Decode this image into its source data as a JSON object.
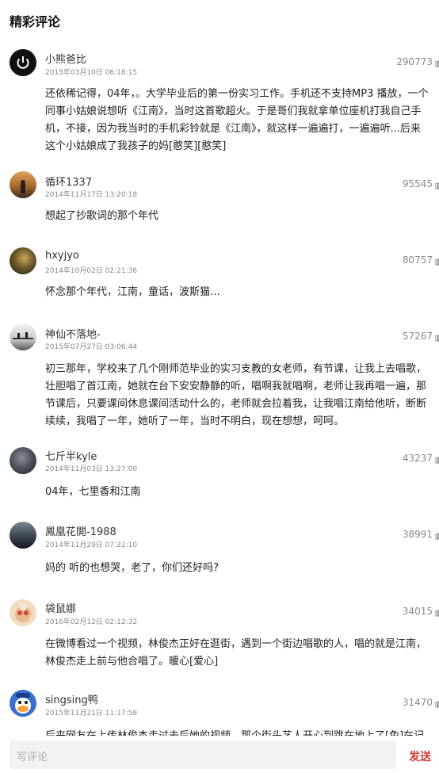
{
  "header": {
    "title": "精彩评论"
  },
  "comments": [
    {
      "user": "小熊爸比",
      "date": "2015年03月10日 06:18:15",
      "likes": "290773",
      "text": "还依稀记得，04年，。大学毕业后的第一份实习工作。手机还不支持MP3 播放，一个同事小姑娘说想听《江南》，当时这首歌超火。于是哥们我就拿单位座机打我自己手机，不接，因为我当时的手机彩铃就是《江南》，就这样一遍遍打，一遍遍听...后来这个小姑娘成了我孩子的妈[憨笑][憨笑]"
    },
    {
      "user": "循环1337",
      "date": "2014年11月17日 13:20:18",
      "likes": "95545",
      "text": "想起了抄歌词的那个年代"
    },
    {
      "user": "hxyjyo",
      "date": "2014年10月02日 02:21:36",
      "likes": "80757",
      "text": "怀念那个年代，江南，童话，波斯猫…"
    },
    {
      "user": "神仙不落地-",
      "date": "2015年07月27日 03:06:44",
      "likes": "57267",
      "text": "初三那年，学校来了几个刚师范毕业的实习支教的女老师，有节课，让我上去唱歌，壮胆唱了首江南，她就在台下安安静静的听，唱啊我就唱啊，老师让我再唱一遍，那节课后，只要课间休息课间活动什么的，老师就会拉着我，让我唱江南给他听，断断续续，我唱了一年，她听了一年，当时不明白，现在想想，呵呵。"
    },
    {
      "user": "七斤半kyle",
      "date": "2014年11月03日 13:27:00",
      "likes": "43237",
      "text": "04年，七里香和江南"
    },
    {
      "user": "鳳凰花開-1988",
      "date": "2014年11月29日 07:22:10",
      "likes": "38991",
      "text": "妈的 听的也想哭，老了，你们还好吗?"
    },
    {
      "user": "袋鼠娜",
      "date": "2016年02月12日 02:12:32",
      "likes": "34015",
      "text": "在微博看过一个视频，林俊杰正好在逛街，遇到一个街边唱歌的人，唱的就是江南，林俊杰走上前与他合唱了。暖心[爱心]"
    },
    {
      "user": "singsing鸭",
      "date": "2015年11月21日 11:17:58",
      "likes": "31470",
      "text": "后来网友在上传林俊杰走过去后她的视频，那个街头艺人开心到跳在地上了[兔]在记"
    }
  ],
  "footer": {
    "placeholder": "写评论",
    "send_label": "发送"
  },
  "colors": {
    "accent": "#d33a31"
  }
}
